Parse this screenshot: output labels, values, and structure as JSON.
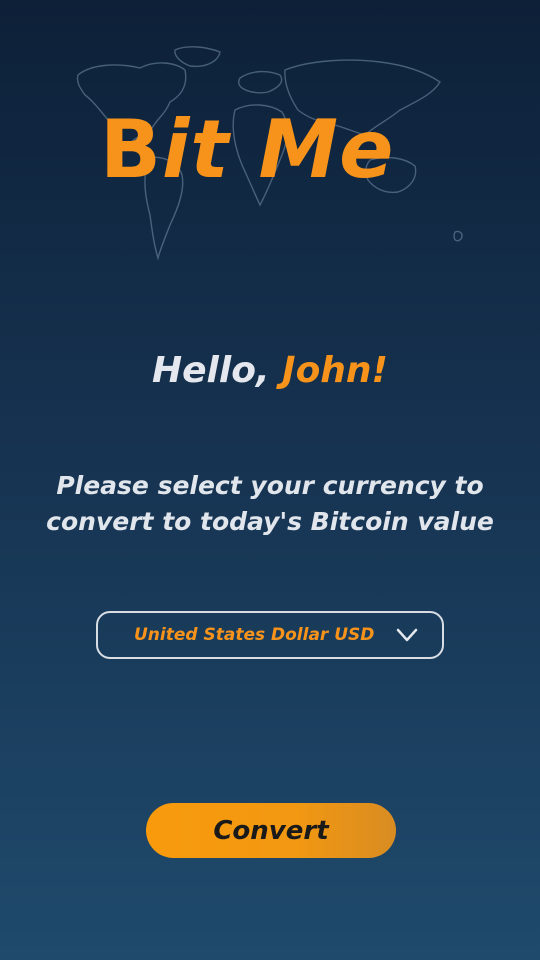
{
  "app": {
    "logo_symbol": "B",
    "logo_text": "it Me",
    "brand_color": "#f7931a"
  },
  "greeting": {
    "prefix": "Hello, ",
    "name": "John!"
  },
  "instructions": {
    "line1": "Please select your currency to",
    "line2": "convert to today's Bitcoin value"
  },
  "currency": {
    "selected": "United States Dollar USD",
    "icon": "chevron-down-icon"
  },
  "actions": {
    "convert_label": "Convert"
  }
}
